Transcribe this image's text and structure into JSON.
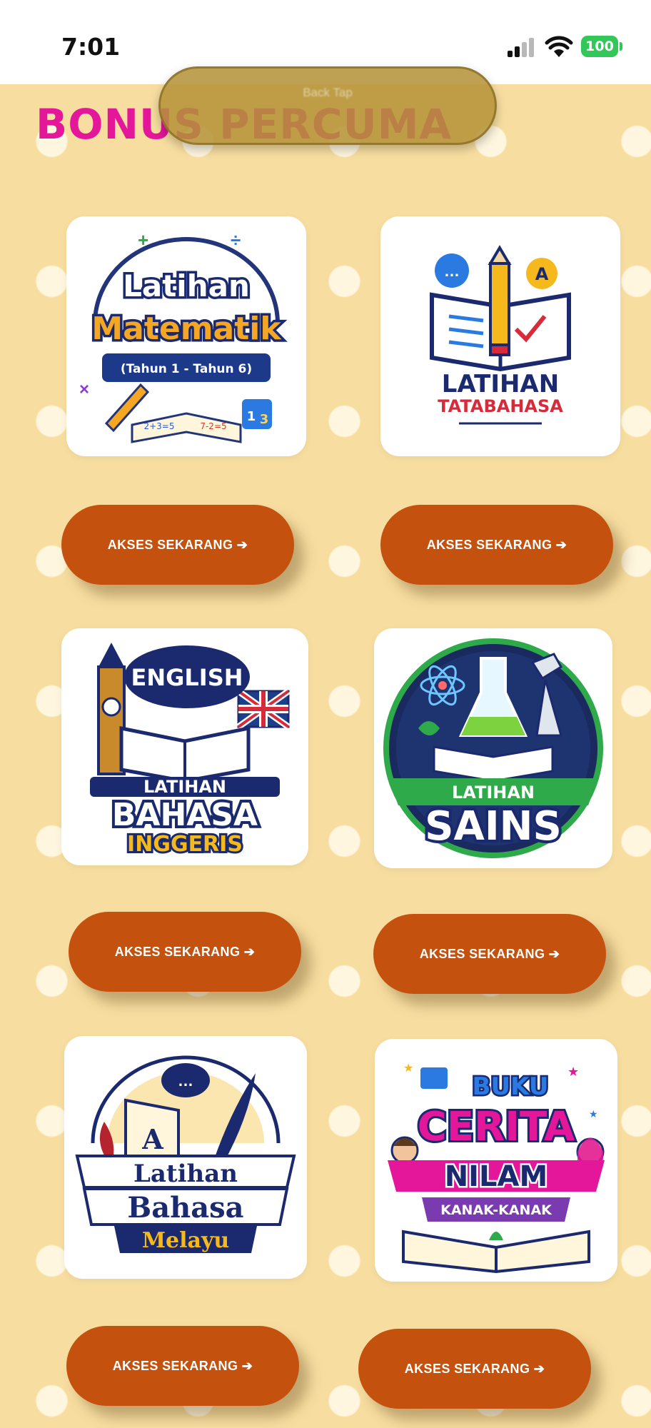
{
  "status_bar": {
    "time": "7:01",
    "battery": "100"
  },
  "header": {
    "title": "BONUS PERCUMA",
    "overlay_label": "Back Tap"
  },
  "colors": {
    "background": "#f7dea0",
    "button": "#c4510e",
    "heading": "#e4169a"
  },
  "products": [
    {
      "icon": "math-book-icon",
      "logo_lines": [
        "Latihan",
        "Matematik",
        "(Tahun 1 - Tahun 6)",
        "2+3=5",
        "7-2=5",
        "1",
        "3"
      ],
      "button_label": "AKSES SEKARANG  ➔"
    },
    {
      "icon": "open-book-pencil-icon",
      "logo_lines": [
        "LATIHAN",
        "TATABAHASA",
        "A"
      ],
      "button_label": "AKSES SEKARANG ➔"
    },
    {
      "icon": "big-ben-book-icon",
      "logo_lines": [
        "ENGLISH",
        "LATIHAN",
        "BAHASA",
        "INGGERIS"
      ],
      "button_label": "AKSES SEKARANG ➔"
    },
    {
      "icon": "science-flask-icon",
      "logo_lines": [
        "LATIHAN",
        "SAINS"
      ],
      "button_label": "AKSES SEKARANG ➔"
    },
    {
      "icon": "quill-book-icon",
      "logo_lines": [
        "A",
        "Latihan",
        "Bahasa",
        "Melayu"
      ],
      "button_label": "AKSES SEKARANG ➔"
    },
    {
      "icon": "storybook-icon",
      "logo_lines": [
        "BUKU",
        "CERITA",
        "NILAM",
        "KANAK-KANAK"
      ],
      "button_label": "AKSES SEKARANG ➔"
    }
  ]
}
